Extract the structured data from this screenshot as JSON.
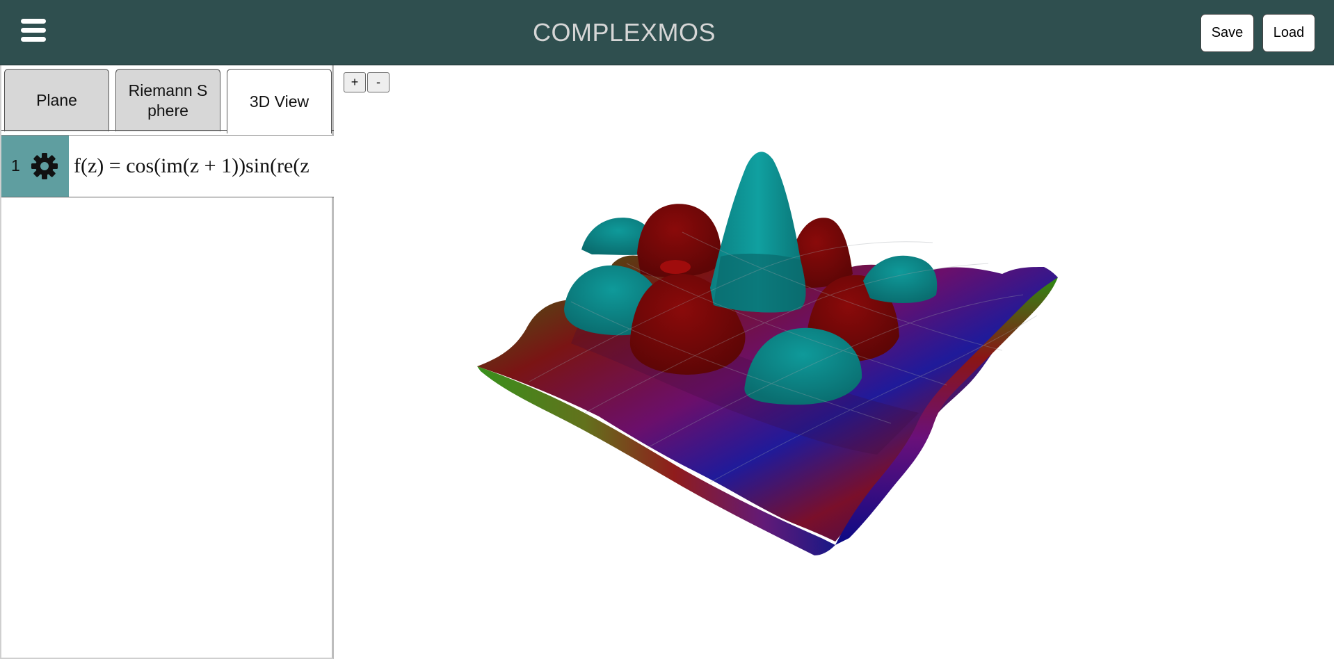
{
  "header": {
    "title": "COMPLEXMOS",
    "save_label": "Save",
    "load_label": "Load",
    "background": "#2f4f4f"
  },
  "tabs": [
    {
      "label": "Plane",
      "active": false
    },
    {
      "label": "Riemann S phere",
      "active": false
    },
    {
      "label": "3D View",
      "active": true
    }
  ],
  "expressions": [
    {
      "index": "1",
      "formula": "f(z) = cos(im(z + 1))sin(re(z",
      "accent": "#5f9ea0"
    }
  ],
  "view": {
    "zoom_in_label": "+",
    "zoom_out_label": "-"
  },
  "icons": {
    "menu": "hamburger-icon",
    "settings": "gear-icon"
  }
}
